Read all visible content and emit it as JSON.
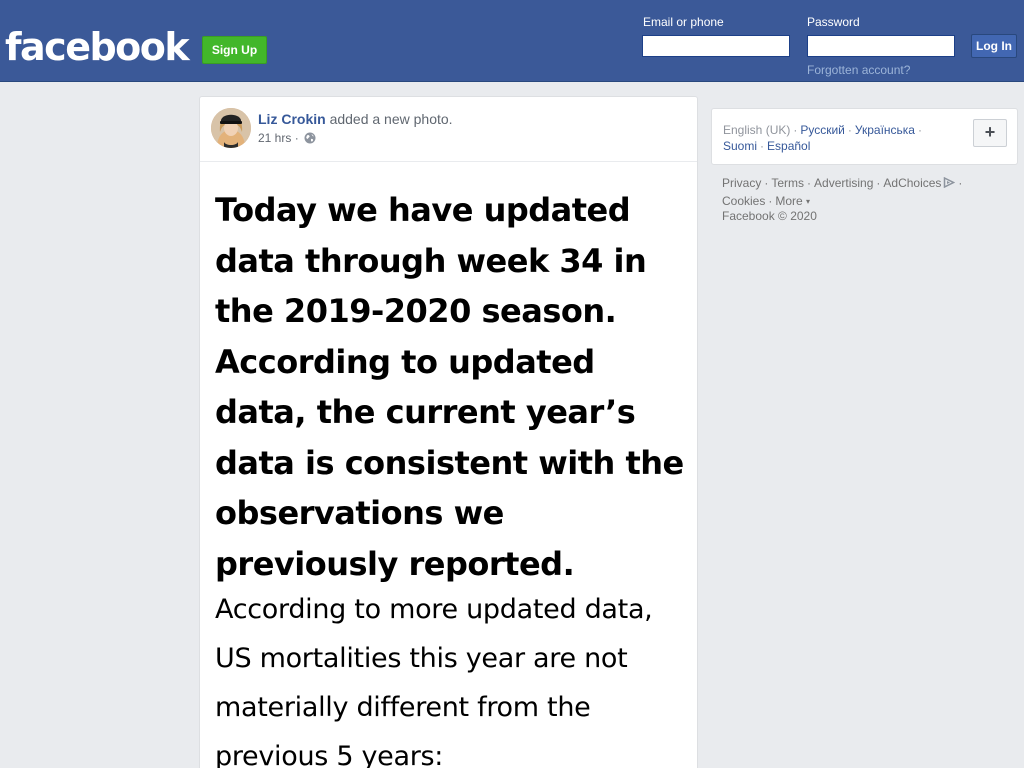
{
  "header": {
    "logo_text": "facebook",
    "signup_label": "Sign Up",
    "email_label": "Email or phone",
    "email_value": "",
    "password_label": "Password",
    "password_value": "",
    "login_label": "Log In",
    "forgot_label": "Forgotten account?"
  },
  "post": {
    "author": "Liz Crokin",
    "action": "added a new photo.",
    "time": "21 hrs",
    "dot": "·",
    "privacy_icon": "globe-icon",
    "image_text": {
      "bold_lines": [
        "Today we have updated",
        "data through week 34 in",
        "the 2019-2020 season.",
        "According to updated",
        "data, the current year’s",
        "data is consistent with the",
        "observations we",
        "previously reported."
      ],
      "regular_lines": [
        "According to more updated data,",
        "US mortalities this year are not",
        "materially different from the",
        "previous 5 years:"
      ]
    }
  },
  "sidebar": {
    "languages": [
      {
        "label": "English (UK)",
        "current": true
      },
      {
        "label": "Русский",
        "current": false
      },
      {
        "label": "Українська",
        "current": false
      },
      {
        "label": "Suomi",
        "current": false
      },
      {
        "label": "Español",
        "current": false
      }
    ],
    "add_language_label": "+",
    "separator": "·",
    "footer_links": [
      "Privacy",
      "Terms",
      "Advertising",
      "AdChoices",
      "Cookies",
      "More"
    ],
    "copyright": "Facebook © 2020"
  },
  "colors": {
    "brand_blue": "#3b5998",
    "signup_green": "#42b72a",
    "link_blue": "#365899",
    "page_bg": "#e9ebee"
  }
}
